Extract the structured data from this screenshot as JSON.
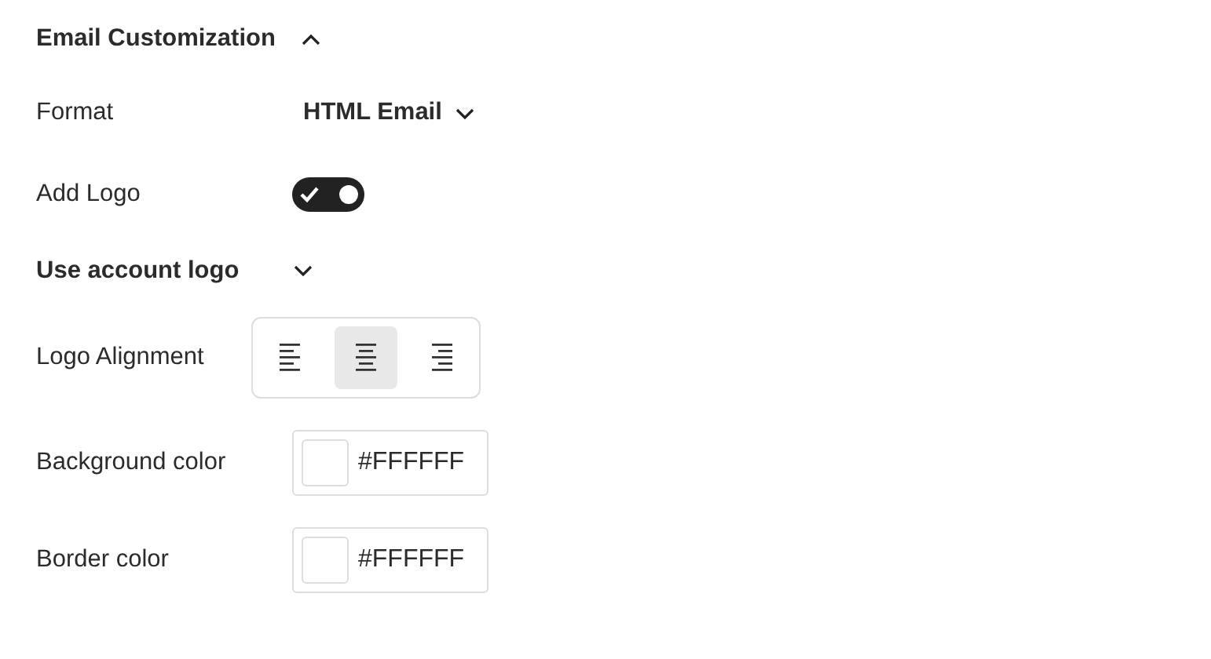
{
  "section": {
    "title": "Email Customization",
    "expanded": true
  },
  "format": {
    "label": "Format",
    "value": "HTML Email"
  },
  "add_logo": {
    "label": "Add Logo",
    "on": true
  },
  "logo_source": {
    "label": "Use account logo",
    "expanded": false
  },
  "logo_alignment": {
    "label": "Logo Alignment",
    "options": [
      {
        "kind": "left",
        "selected": false
      },
      {
        "kind": "center",
        "selected": true
      },
      {
        "kind": "right",
        "selected": false
      }
    ]
  },
  "colors": [
    {
      "label": "Background color",
      "value": "#FFFFFF",
      "color": "#ffffff"
    },
    {
      "label": "Border color",
      "value": "#FFFFFF",
      "color": "#ffffff"
    }
  ]
}
